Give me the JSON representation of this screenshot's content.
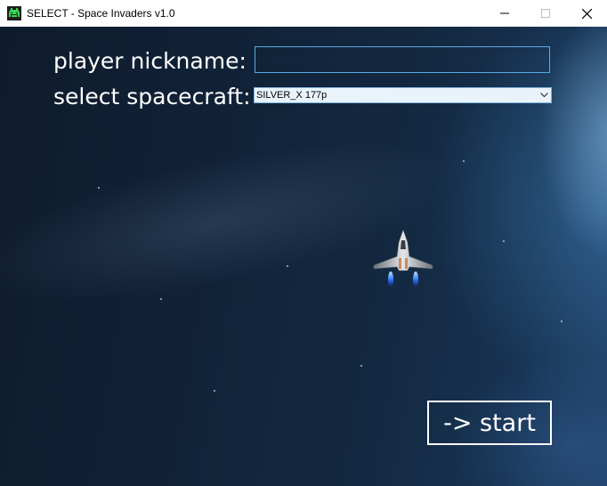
{
  "window": {
    "title": "SELECT - Space Invaders v1.0",
    "app_icon": "space-invader-icon",
    "controls": [
      "minimize-icon",
      "maximize-icon",
      "close-icon"
    ]
  },
  "form": {
    "nickname_label": "player nickname:",
    "nickname_value": "",
    "nickname_placeholder": "",
    "spacecraft_label": "select spacecraft:",
    "spacecraft_selected": "SILVER_X 177p"
  },
  "preview": {
    "ship_icon": "silver-spaceship-icon"
  },
  "actions": {
    "start_label": "-> start"
  },
  "colors": {
    "accent_border": "#5aa9e6",
    "text": "#ffffff",
    "background_dark": "#0e1b2c"
  }
}
